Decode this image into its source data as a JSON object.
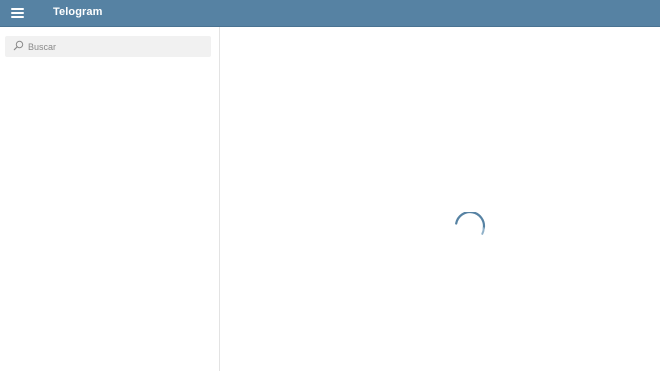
{
  "header": {
    "title": "Telogram",
    "menu_icon": "hamburger-menu-icon",
    "background_color": "#5682a3"
  },
  "sidebar": {
    "search": {
      "placeholder": "Buscar",
      "value": "",
      "icon": "search-icon"
    }
  },
  "main": {
    "state": "loading",
    "spinner_icon": "loading-spinner-icon",
    "spinner_color": "#5682a3"
  }
}
